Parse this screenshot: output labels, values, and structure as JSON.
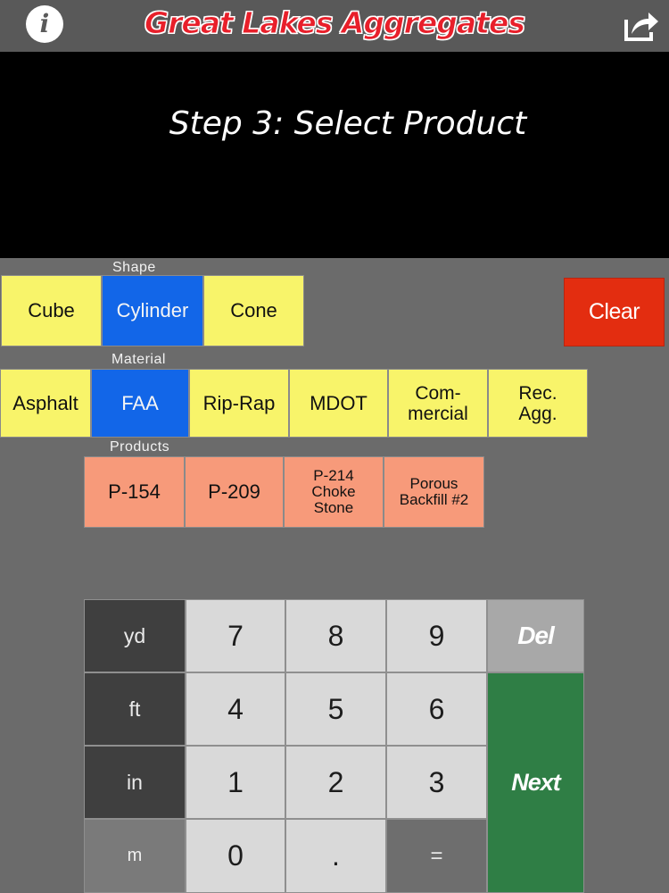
{
  "header": {
    "title": "Great Lakes Aggregates",
    "info_label": "i"
  },
  "display": {
    "step_text": "Step 3: Select Product"
  },
  "shape": {
    "label": "Shape",
    "options": [
      "Cube",
      "Cylinder",
      "Cone"
    ],
    "selected": "Cylinder"
  },
  "clear_label": "Clear",
  "material": {
    "label": "Material",
    "options": [
      "Asphalt",
      "FAA",
      "Rip-Rap",
      "MDOT",
      "Com-\nmercial",
      "Rec.\nAgg."
    ],
    "selected": "FAA"
  },
  "products": {
    "label": "Products",
    "options": [
      "P-154",
      "P-209",
      "P-214\nChoke\nStone",
      "Porous\nBackfill #2"
    ]
  },
  "keypad": {
    "units": [
      "yd",
      "ft",
      "in",
      "m"
    ],
    "digits": [
      "7",
      "8",
      "9",
      "4",
      "5",
      "6",
      "1",
      "2",
      "3",
      "0",
      "."
    ],
    "equals": "=",
    "del": "Del",
    "next": "Next"
  },
  "colors": {
    "selected": "#1266e8",
    "option": "#f8f46a",
    "product": "#f79a7a",
    "clear": "#e32d10",
    "next": "#2f7e45",
    "title": "#e81f2a"
  },
  "icons": {
    "info": "info-icon",
    "share": "share-icon"
  }
}
